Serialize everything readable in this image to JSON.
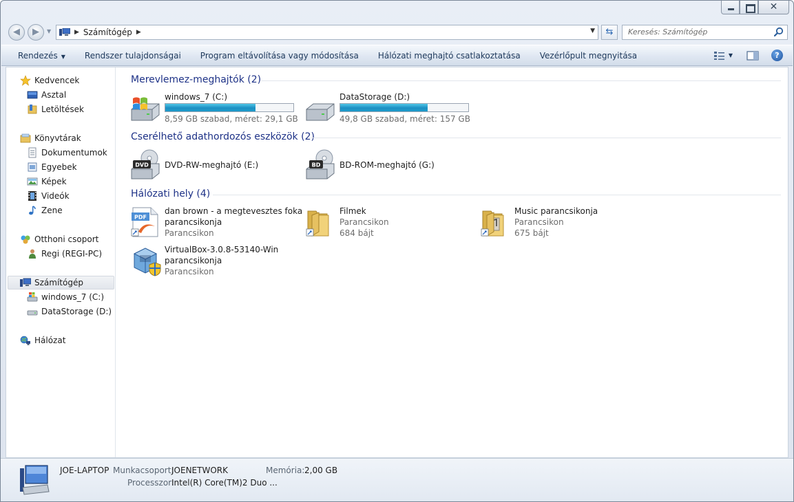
{
  "address": {
    "location": "Számítógép",
    "search_placeholder": "Keresés: Számítógép"
  },
  "toolbar": {
    "organize": "Rendezés",
    "system_properties": "Rendszer tulajdonságai",
    "uninstall": "Program eltávolítása vagy módosítása",
    "map_drive": "Hálózati meghajtó csatlakoztatása",
    "control_panel": "Vezérlőpult megnyitása"
  },
  "nav": {
    "favorites": "Kedvencek",
    "desktop": "Asztal",
    "downloads": "Letöltések",
    "libraries": "Könyvtárak",
    "documents": "Dokumentumok",
    "other": "Egyebek",
    "pictures": "Képek",
    "videos": "Videók",
    "music": "Zene",
    "homegroup": "Otthoni csoport",
    "homegroup_user": "Regi (REGI-PC)",
    "computer": "Számítógép",
    "drive_c": "windows_7 (C:)",
    "drive_d": "DataStorage (D:)",
    "network": "Hálózat"
  },
  "groups": {
    "hdd": {
      "title": "Merevlemez-meghajtók (2)",
      "items": [
        {
          "name": "windows_7 (C:)",
          "info": "8,59 GB szabad, méret: 29,1 GB",
          "used_fraction": 0.705,
          "icon": "windows-drive-icon"
        },
        {
          "name": "DataStorage (D:)",
          "info": "49,8 GB szabad, méret: 157 GB",
          "used_fraction": 0.683,
          "icon": "hard-drive-icon"
        }
      ]
    },
    "removable": {
      "title": "Cserélhető adathordozós eszközök (2)",
      "items": [
        {
          "name": "DVD-RW-meghajtó (E:)",
          "badge": "DVD",
          "icon": "dvd-drive-icon"
        },
        {
          "name": "BD-ROM-meghajtó (G:)",
          "badge": "BD",
          "icon": "bd-drive-icon"
        }
      ]
    },
    "network": {
      "title": "Hálózati hely (4)",
      "items": [
        {
          "line1": "dan brown - a megtevesztes foka",
          "line2": "parancsikonja",
          "line3": "Parancsikon",
          "icon": "pdf-shortcut-icon"
        },
        {
          "line1": "Filmek",
          "line2": "Parancsikon",
          "line3": "684 bájt",
          "icon": "folder-icon"
        },
        {
          "line1": "Music parancsikonja",
          "line2": "Parancsikon",
          "line3": "675 bájt",
          "icon": "music-folder-icon"
        },
        {
          "line1": "VirtualBox-3.0.8-53140-Win",
          "line2": "parancsikonja",
          "line3": "Parancsikon",
          "icon": "virtualbox-icon"
        }
      ]
    }
  },
  "details": {
    "name": "JOE-LAPTOP",
    "workgroup_label": "Munkacsoport:",
    "workgroup_value": "JOENETWORK",
    "memory_label": "Memória:",
    "memory_value": "2,00 GB",
    "processor_label": "Processzor:",
    "processor_value": "Intel(R) Core(TM)2 Duo ..."
  },
  "colors": {
    "group_header": "#1e3287",
    "drive_bar": "#1c8fc2",
    "command_text": "#1e395b"
  }
}
